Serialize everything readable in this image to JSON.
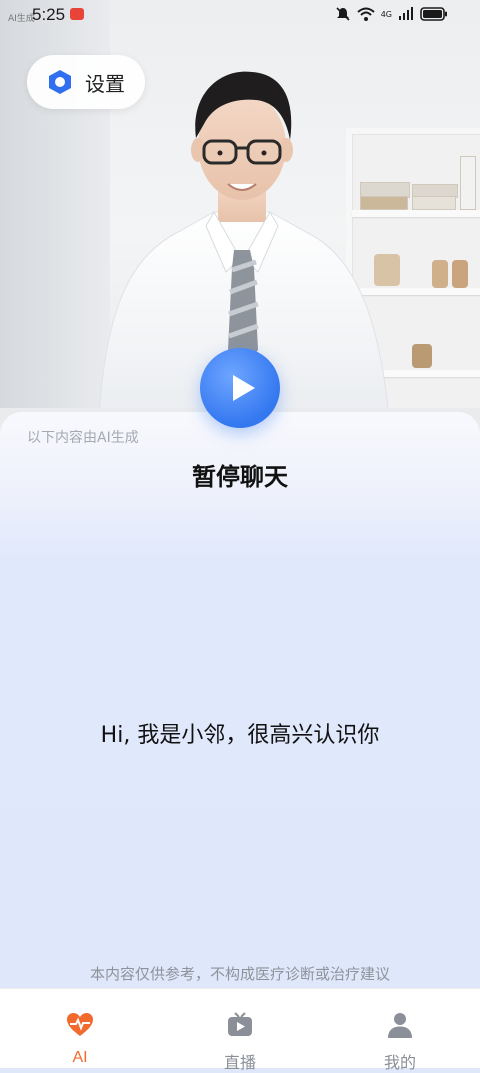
{
  "status_bar": {
    "time": "5:25",
    "tag": "AI生成",
    "network": "4G"
  },
  "settings": {
    "label": "设置",
    "icon": "hexagon-settings-icon"
  },
  "player": {
    "icon": "play-icon",
    "accent": "#3478f0"
  },
  "ai_note": "以下内容由AI生成",
  "chat_status": "暂停聊天",
  "greeting": "Hi, 我是小邻，很高兴认识你",
  "disclaimer": "本内容仅供参考，不构成医疗诊断或治疗建议",
  "tabs": [
    {
      "label": "AI",
      "icon": "heart-pulse-icon",
      "active": true
    },
    {
      "label": "直播",
      "icon": "tv-play-icon",
      "active": false
    },
    {
      "label": "我的",
      "icon": "person-icon",
      "active": false
    }
  ],
  "colors": {
    "active_tab": "#f26a2e",
    "panel": "#dfe7fb"
  }
}
